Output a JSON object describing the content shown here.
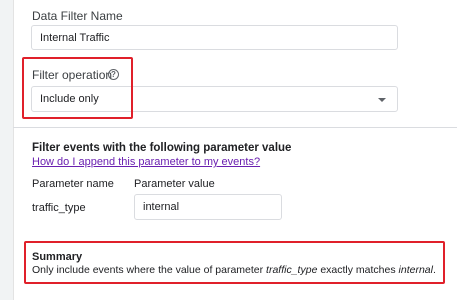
{
  "filter_name": {
    "label": "Data Filter Name",
    "value": "Internal Traffic"
  },
  "filter_operation": {
    "label": "Filter operation",
    "help_icon": "help-circle-icon",
    "selected": "Include only",
    "dropdown_icon": "caret-down-icon"
  },
  "parameter_section": {
    "heading": "Filter events with the following parameter value",
    "help_link": "How do I append this parameter to my events?",
    "name_header": "Parameter name",
    "value_header": "Parameter value",
    "parameter_name": "traffic_type",
    "parameter_value": "internal"
  },
  "summary": {
    "title": "Summary",
    "prefix": "Only include events where the value of parameter ",
    "param": "traffic_type",
    "middle": " exactly matches ",
    "value": "internal",
    "suffix": "."
  },
  "colors": {
    "highlight": "#e0202a",
    "link": "#6a1fb0"
  }
}
